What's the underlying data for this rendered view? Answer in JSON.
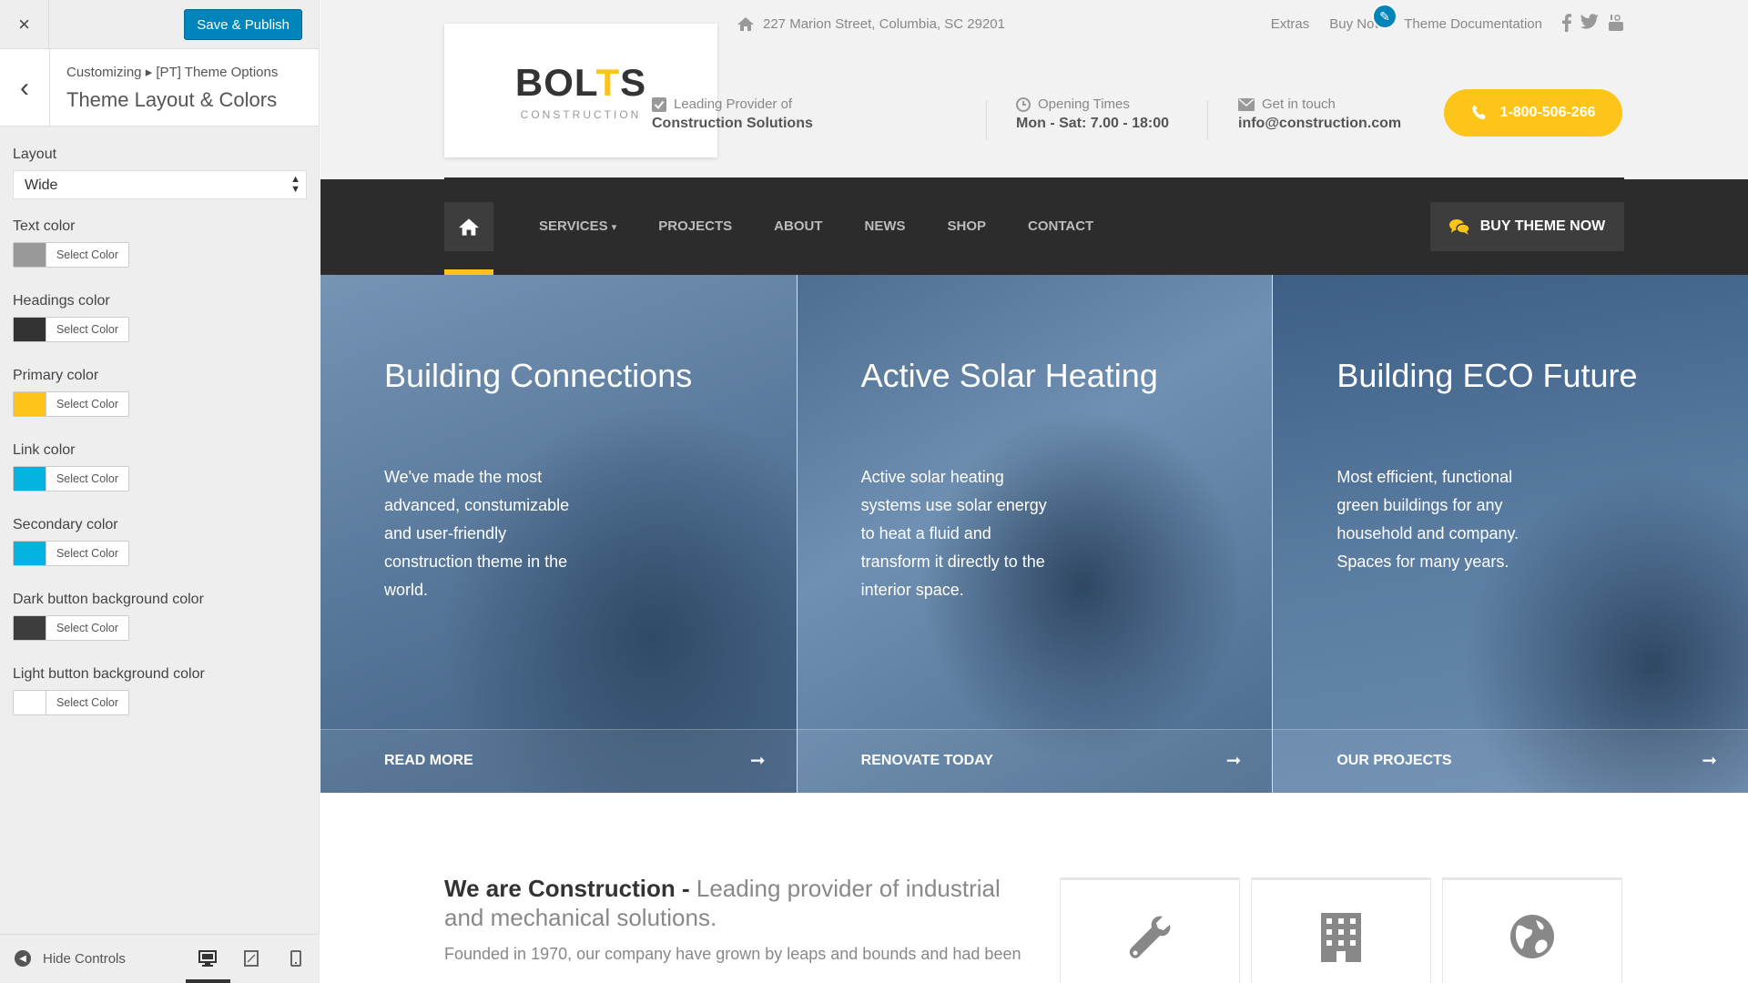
{
  "customizer": {
    "close_label": "×",
    "publish_label": "Save & Publish",
    "back_label": "‹",
    "breadcrumb": "Customizing ▸ [PT] Theme Options",
    "section_title": "Theme Layout & Colors",
    "layout": {
      "label": "Layout",
      "value": "Wide"
    },
    "colors": [
      {
        "label": "Text color",
        "button": "Select Color",
        "swatch": "#999999"
      },
      {
        "label": "Headings color",
        "button": "Select Color",
        "swatch": "#333333"
      },
      {
        "label": "Primary color",
        "button": "Select Color",
        "swatch": "#fdc41a"
      },
      {
        "label": "Link color",
        "button": "Select Color",
        "swatch": "#04b3e0"
      },
      {
        "label": "Secondary color",
        "button": "Select Color",
        "swatch": "#04b3e0"
      },
      {
        "label": "Dark button background color",
        "button": "Select Color",
        "swatch": "#3d3d3d"
      },
      {
        "label": "Light button background color",
        "button": "Select Color",
        "swatch": "#ffffff"
      }
    ],
    "hide_controls": "Hide Controls"
  },
  "site": {
    "topbar": {
      "address": "227 Marion Street, Columbia, SC 29201",
      "links": [
        "Extras",
        "Buy Now",
        "Theme Documentation"
      ],
      "edit_icon": "pencil-icon"
    },
    "logo": {
      "main_a": "BOL",
      "main_b": "T",
      "main_c": "S",
      "sub": "CONSTRUCTION"
    },
    "widgets": [
      {
        "title": "Leading Provider of",
        "value": "Construction Solutions",
        "icon": "check-square-icon"
      },
      {
        "title": "Opening Times",
        "value": "Mon - Sat: 7.00 - 18:00",
        "icon": "clock-icon"
      },
      {
        "title": "Get in touch",
        "value": "info@construction.com",
        "icon": "envelope-icon"
      }
    ],
    "phone": "1-800-506-266",
    "nav": {
      "items": [
        "SERVICES",
        "PROJECTS",
        "ABOUT",
        "NEWS",
        "SHOP",
        "CONTACT"
      ],
      "services_caret": "▾",
      "buy_label": "BUY THEME NOW"
    },
    "hero": [
      {
        "title": "Building Connections",
        "text": "We've made the most advanced, constumizable and user-friendly construction theme in the world.",
        "link": "READ MORE",
        "arrow": "➞"
      },
      {
        "title": "Active Solar Heating",
        "text": "Active solar heating systems use solar energy to heat a fluid and transform it directly to the interior space.",
        "link": "RENOVATE TODAY",
        "arrow": "➞"
      },
      {
        "title": "Building ECO Future",
        "text": "Most efficient, functional green buildings for any household and company. Spaces for many years.",
        "link": "OUR PROJECTS",
        "arrow": "➞"
      }
    ],
    "about": {
      "title_bold": "We are Construction - ",
      "title_rest": "Leading provider of industrial and mechanical solutions.",
      "text": "Founded in 1970, our company have grown by leaps and bounds and had been"
    },
    "accent_color": "#fdc41a"
  }
}
